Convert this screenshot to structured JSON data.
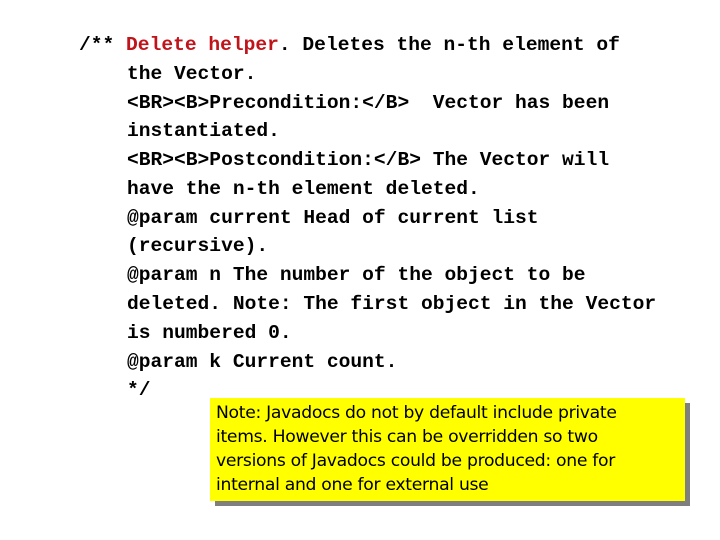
{
  "comment": {
    "open": "/** ",
    "title": "Delete helper",
    "title_color": "#c0141b",
    "first_rest": ". Deletes the n-th element of",
    "lines": [
      "the Vector.",
      "<BR><B>Precondition:</B>  Vector has been",
      "instantiated.",
      "<BR><B>Postcondition:</B> The Vector will",
      "have the n-th element deleted.",
      "@param current Head of current list",
      "(recursive).",
      "@param n The number of the object to be",
      "deleted. Note: The first object in the Vector",
      "is numbered 0.",
      "@param k Current count.",
      "*/"
    ]
  },
  "note": {
    "background": "#ffff00",
    "lines": [
      "Note: Javadocs do not by default include private",
      "items. However this can be overridden so two",
      "versions of Javadocs could be produced: one for",
      "internal and one for external use"
    ]
  }
}
